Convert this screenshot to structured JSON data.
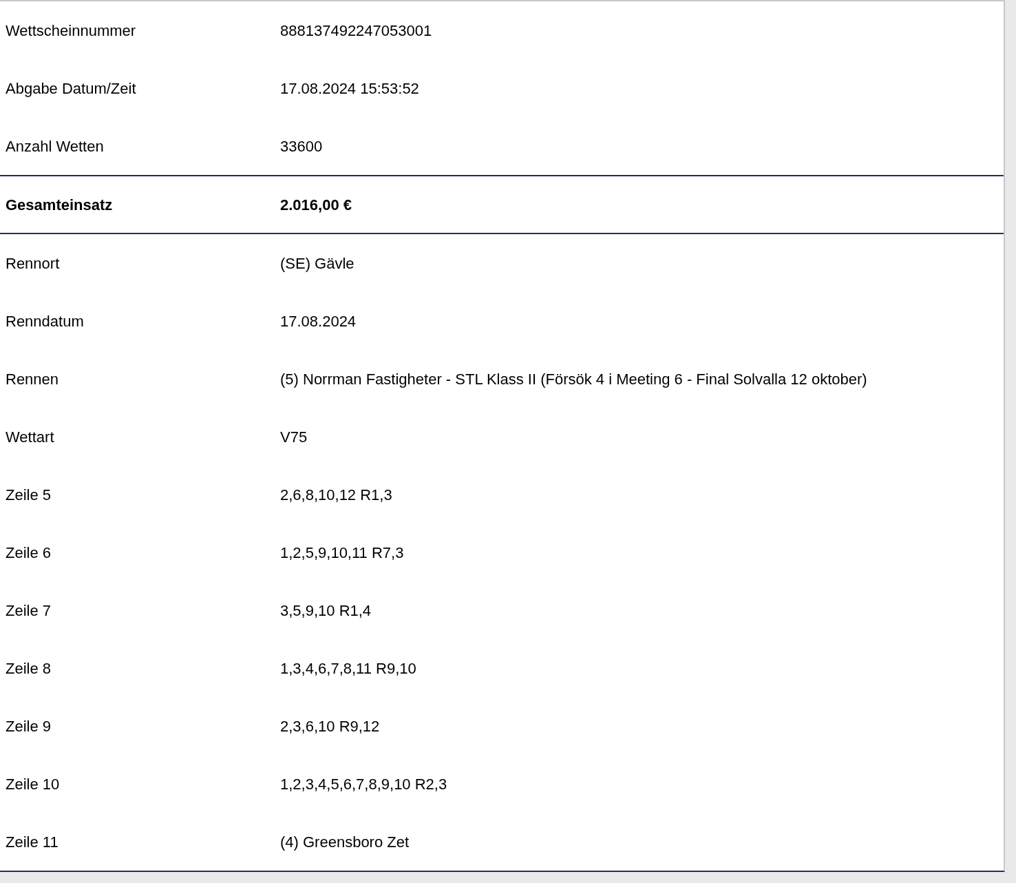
{
  "rows": [
    {
      "kind": "normal",
      "label": "Wettscheinnummer",
      "value": "888137492247053001"
    },
    {
      "kind": "normal",
      "label": "Abgabe Datum/Zeit",
      "value": "17.08.2024 15:53:52"
    },
    {
      "kind": "normal",
      "label": "Anzahl Wetten",
      "value": "33600"
    },
    {
      "kind": "total",
      "label": "Gesamteinsatz",
      "value": "2.016,00 €"
    },
    {
      "kind": "normal",
      "label": "Rennort",
      "value": "(SE) Gävle"
    },
    {
      "kind": "normal",
      "label": "Renndatum",
      "value": "17.08.2024"
    },
    {
      "kind": "normal",
      "label": "Rennen",
      "value": "(5) Norrman Fastigheter - STL Klass II (Försök 4 i Meeting 6 - Final Solvalla 12 oktober)"
    },
    {
      "kind": "normal",
      "label": "Wettart",
      "value": "V75"
    },
    {
      "kind": "normal",
      "label": "Zeile 5",
      "value": "2,6,8,10,12 R1,3"
    },
    {
      "kind": "normal",
      "label": "Zeile 6",
      "value": "1,2,5,9,10,11 R7,3"
    },
    {
      "kind": "normal",
      "label": "Zeile 7",
      "value": "3,5,9,10 R1,4"
    },
    {
      "kind": "normal",
      "label": "Zeile 8",
      "value": "1,3,4,6,7,8,11 R9,10"
    },
    {
      "kind": "normal",
      "label": "Zeile 9",
      "value": "2,3,6,10 R9,12"
    },
    {
      "kind": "normal",
      "label": "Zeile 10",
      "value": "1,2,3,4,5,6,7,8,9,10 R2,3"
    },
    {
      "kind": "normal",
      "label": "Zeile 11",
      "value": "(4) Greensboro Zet"
    }
  ]
}
